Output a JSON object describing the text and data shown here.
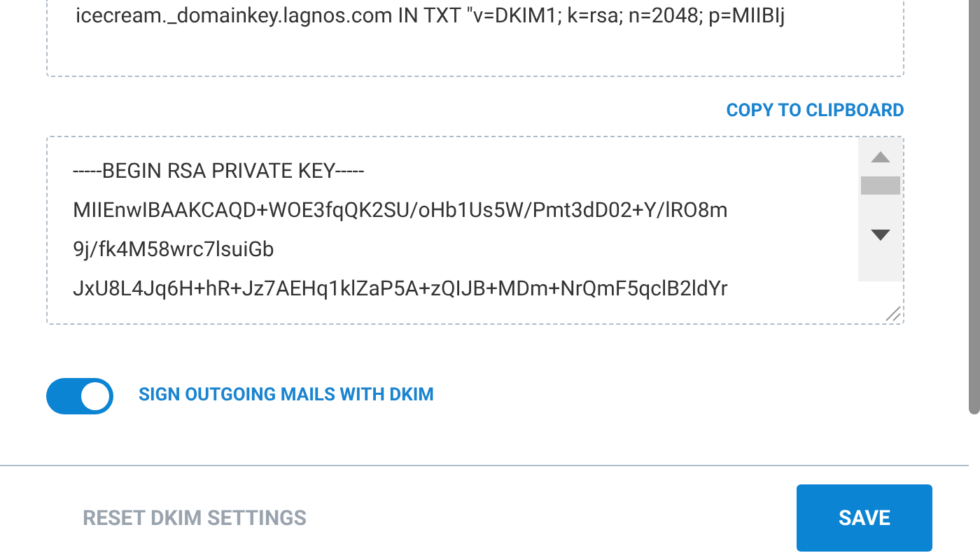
{
  "dns_record": {
    "value": "icecream._domainkey.lagnos.com IN TXT \"v=DKIM1; k=rsa; n=2048; p=MIIBIj"
  },
  "copy_link": "COPY TO CLIPBOARD",
  "private_key": {
    "lines": [
      "-----BEGIN RSA PRIVATE KEY-----",
      "MIIEnwIBAAKCAQD+WOE3fqQK2SU/oHb1Us5W/Pmt3dD02+Y/lRO8m",
      "9j/fk4M58wrc7lsuiGb",
      "JxU8L4Jq6H+hR+Jz7AEHq1klZaP5A+zQIJB+MDm+NrQmF5qclB2ldYr"
    ]
  },
  "sign_toggle": {
    "label": "SIGN OUTGOING MAILS WITH DKIM",
    "on": true
  },
  "reset_button": {
    "label": "RESET DKIM SETTINGS",
    "disabled": true
  },
  "save_button": {
    "label": "SAVE"
  }
}
